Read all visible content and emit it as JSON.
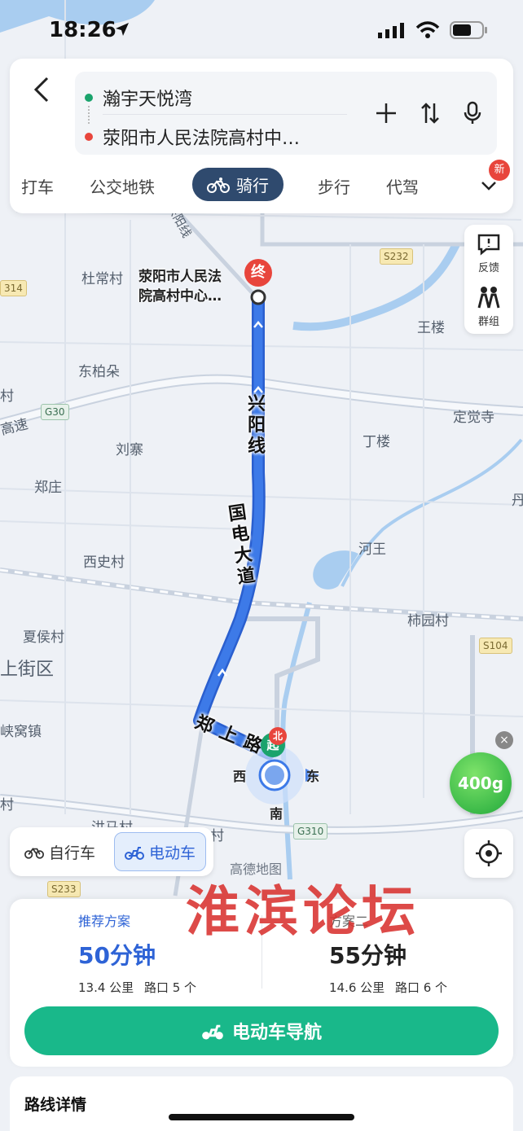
{
  "status": {
    "time": "18:26"
  },
  "route": {
    "origin": "瀚宇天悦湾",
    "destination": "荥阳市人民法院高村中…"
  },
  "modes": [
    {
      "label": "打车"
    },
    {
      "label": "公交地铁"
    },
    {
      "label": "骑行",
      "active": true
    },
    {
      "label": "步行"
    },
    {
      "label": "代驾"
    },
    {
      "label": "新"
    }
  ],
  "side_tools": {
    "feedback": "反馈",
    "group": "群组"
  },
  "map": {
    "end_marker": "终",
    "start_marker": "起",
    "north_badge": "北",
    "destination_label_line1": "荥阳市人民法",
    "destination_label_line2": "院高村中心…",
    "compass": {
      "west": "西",
      "east": "东",
      "south": "南"
    },
    "roads": {
      "xingyang_line_vertical": "兴阳线",
      "guodian_avenue": "国电大道",
      "zhengshang_road": "郑上路",
      "xingyang_line_diag": "兴阳线",
      "gaosu": "高速"
    },
    "route_badges": [
      "S232",
      "314",
      "G30",
      "S104",
      "G310",
      "S233"
    ],
    "places": [
      "杜常村",
      "王楼",
      "东柏朵",
      "村",
      "定觉寺",
      "丁楼",
      "刘寨",
      "郑庄",
      "丹",
      "西史村",
      "河王",
      "柿园村",
      "夏侯村",
      "上街区",
      "峡窝镇",
      "村",
      "村",
      "洪马村"
    ],
    "energy": "400g",
    "logo": "高德地图"
  },
  "ride_toggle": {
    "bike": "自行车",
    "ebike": "电动车"
  },
  "plans": [
    {
      "tag": "推荐方案",
      "time": "50分钟",
      "distance": "13.4 公里",
      "junctions": "路口 5 个",
      "active": true
    },
    {
      "tag": "方案二",
      "time": "55分钟",
      "distance": "14.6 公里",
      "junctions": "路口 6 个"
    }
  ],
  "nav_button": "电动车导航",
  "details_title": "路线详情",
  "watermark": "淮滨论坛",
  "colors": {
    "route": "#3d7ae8",
    "accent": "#2e63d6",
    "nav": "#19b88a",
    "end": "#e8453c",
    "start": "#1aa36c"
  }
}
